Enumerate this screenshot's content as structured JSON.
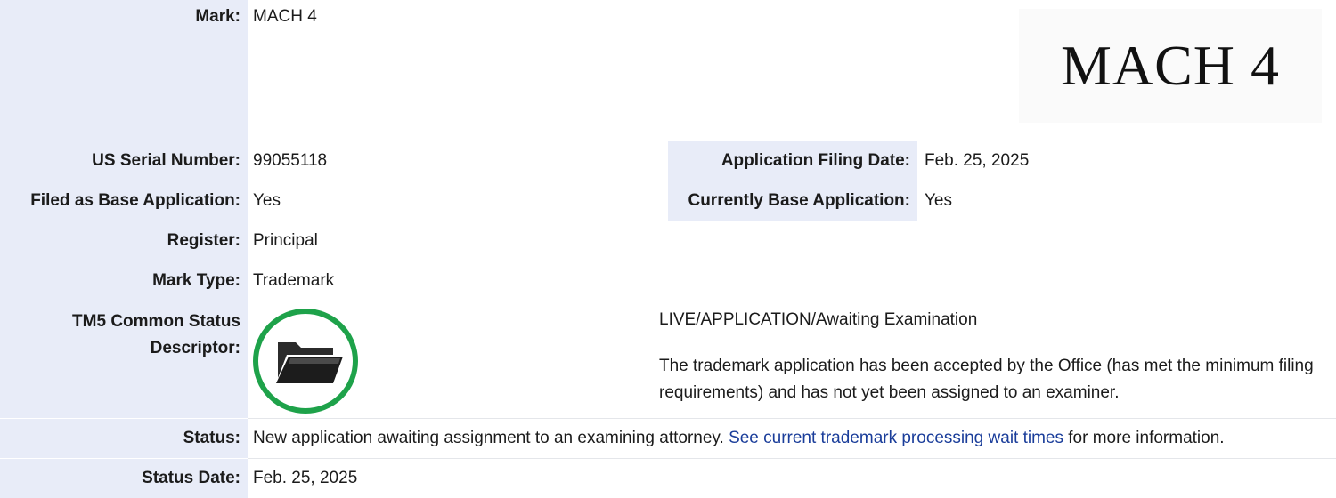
{
  "mark": {
    "label": "Mark:",
    "value": "MACH 4",
    "image_text": "MACH 4"
  },
  "serial": {
    "label": "US Serial Number:",
    "value": "99055118"
  },
  "filing_date": {
    "label": "Application Filing Date:",
    "value": "Feb. 25, 2025"
  },
  "filed_base": {
    "label": "Filed as Base Application:",
    "value": "Yes"
  },
  "current_base": {
    "label": "Currently Base Application:",
    "value": "Yes"
  },
  "register": {
    "label": "Register:",
    "value": "Principal"
  },
  "mark_type": {
    "label": "Mark Type:",
    "value": "Trademark"
  },
  "tm5": {
    "label_line1": "TM5 Common Status",
    "label_line2": "Descriptor:",
    "title": "LIVE/APPLICATION/Awaiting Examination",
    "description": "The trademark application has been accepted by the Office (has met the minimum filing requirements) and has not yet been assigned to an examiner.",
    "icon": "open-folder-icon",
    "ring_color": "#1ea24a"
  },
  "status": {
    "label": "Status:",
    "text_before": "New application awaiting assignment to an examining attorney. ",
    "link_text": "See current trademark processing wait times",
    "text_after": " for more information."
  },
  "status_date": {
    "label": "Status Date:",
    "value": "Feb. 25, 2025"
  },
  "colors": {
    "label_bg": "#e8ecf8",
    "link": "#1a3d9a"
  }
}
